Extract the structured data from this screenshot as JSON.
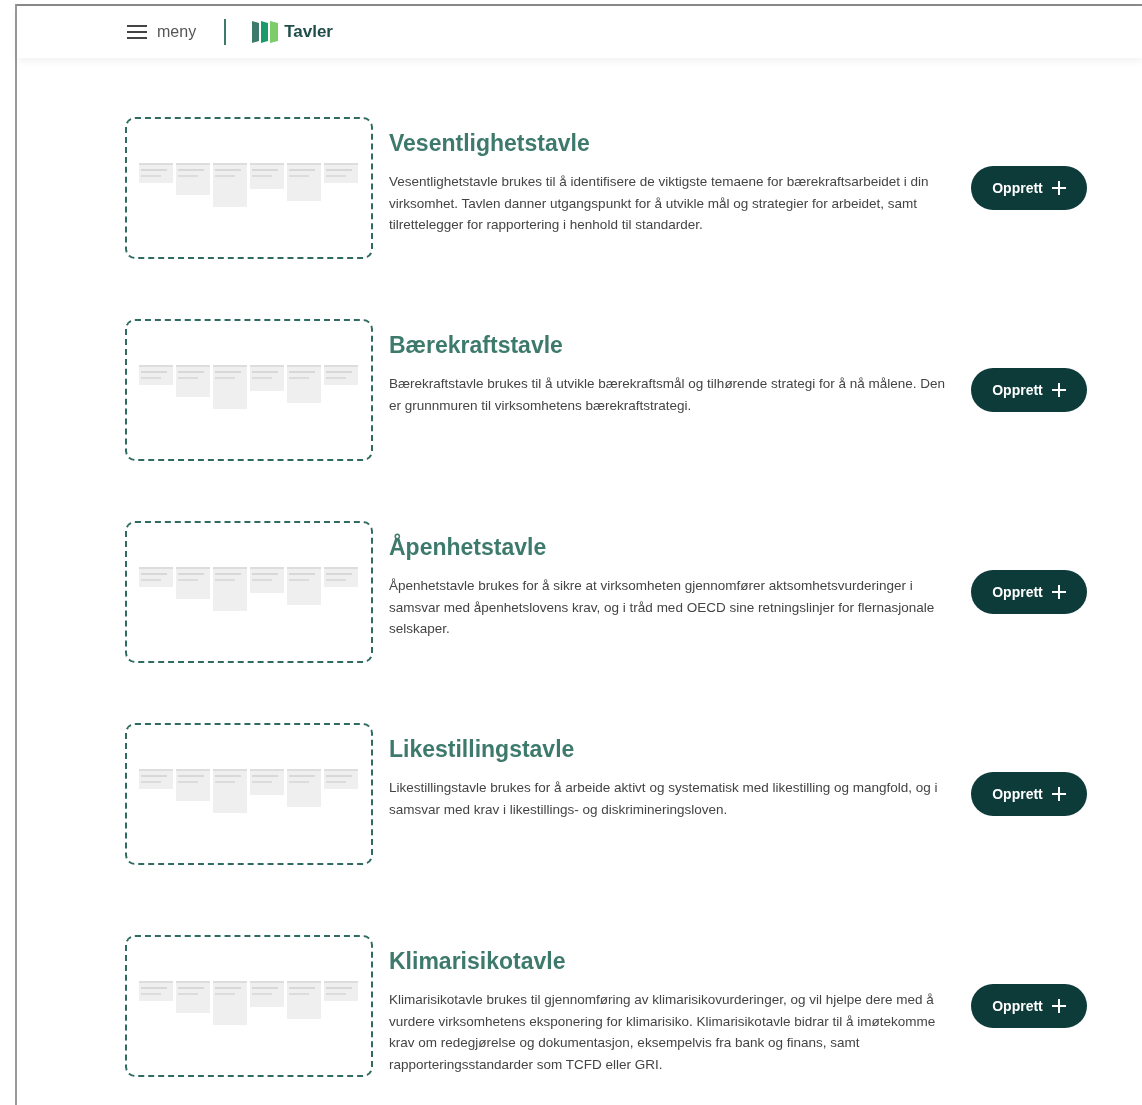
{
  "header": {
    "menu_label": "meny",
    "app_name": "Tavler"
  },
  "boards": [
    {
      "title": "Vesentlighetstavle",
      "description": "Vesentlighetstavle brukes til å identifisere de viktigste temaene for bærekraftsarbeidet i din virksomhet. Tavlen danner utgangspunkt for å utvikle mål og strategier for arbeidet, samt tilrettelegger for rapportering i henhold til standarder.",
      "button": "Opprett"
    },
    {
      "title": "Bærekraftstavle",
      "description": "Bærekraftstavle brukes til å utvikle bærekraftsmål og tilhørende strategi for å nå målene. Den er grunnmuren til virksomhetens bærekraftstrategi.",
      "button": "Opprett"
    },
    {
      "title": "Åpenhetstavle",
      "description": "Åpenhetstavle brukes for å sikre at virksomheten gjennomfører aktsomhetsvurderinger i samsvar med åpenhetslovens krav, og i tråd med OECD sine retningslinjer for flernasjonale selskaper.",
      "button": "Opprett"
    },
    {
      "title": "Likestillingstavle",
      "description": "Likestillingstavle brukes for å arbeide aktivt og systematisk med likestilling og mangfold, og i samsvar med krav i likestillings- og diskrimineringsloven.",
      "button": "Opprett"
    },
    {
      "title": "Klimarisikotavle",
      "description": "Klimarisikotavle brukes til gjennomføring av klimarisikovurderinger, og vil hjelpe dere med å vurdere virksomhetens eksponering for klimarisiko. Klimarisikotavle bidrar til å imøtekomme krav om redegjørelse og dokumentasjon, eksempelvis fra bank og finans, samt rapporteringsstandarder som TCFD eller GRI.",
      "button": "Opprett"
    }
  ]
}
